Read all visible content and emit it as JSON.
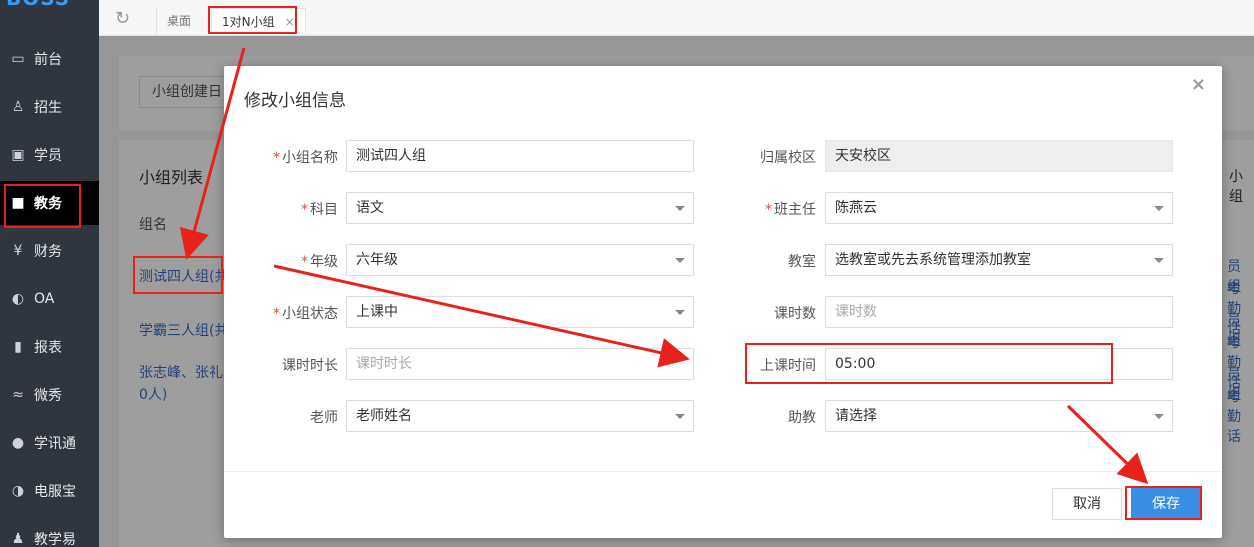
{
  "app": {
    "logo": "BOSS"
  },
  "sidebar": {
    "items": [
      {
        "label": "前台",
        "icon": "calendar-icon"
      },
      {
        "label": "招生",
        "icon": "user-add-icon"
      },
      {
        "label": "学员",
        "icon": "id-card-icon"
      },
      {
        "label": "教务",
        "icon": "book-icon",
        "active": true
      },
      {
        "label": "财务",
        "icon": "yen-icon"
      },
      {
        "label": "OA",
        "icon": "oa-icon"
      },
      {
        "label": "报表",
        "icon": "bar-chart-icon"
      },
      {
        "label": "微秀",
        "icon": "wei-icon"
      },
      {
        "label": "学讯通",
        "icon": "location-icon"
      },
      {
        "label": "电服宝",
        "icon": "phone-icon"
      },
      {
        "label": "教学易",
        "icon": "teach-icon"
      }
    ]
  },
  "tabs": {
    "desk": "桌面",
    "current": "1对N小组",
    "close": "×"
  },
  "background": {
    "filter_label": "小组创建日",
    "list_title": "小组列表",
    "col_name": "组名",
    "rows": [
      "测试四人组(共",
      "学霸三人组(共",
      "张志峰、张礼",
      "0人)"
    ],
    "right_header": "小组",
    "right_rows": [
      "员 组",
      "考勤 话",
      "员 组",
      "考勤 话",
      "员 组",
      "考勤 话"
    ]
  },
  "modal": {
    "title": "修改小组信息",
    "close": "×",
    "fields": {
      "group_name": {
        "label": "小组名称",
        "value": "测试四人组"
      },
      "campus": {
        "label": "归属校区",
        "value": "天安校区"
      },
      "subject": {
        "label": "科目",
        "value": "语文"
      },
      "head_teacher": {
        "label": "班主任",
        "value": "陈燕云"
      },
      "grade": {
        "label": "年级",
        "value": "六年级"
      },
      "classroom": {
        "label": "教室",
        "value": "选教室或先去系统管理添加教室"
      },
      "status": {
        "label": "小组状态",
        "value": "上课中"
      },
      "lesson_count": {
        "label": "课时数",
        "placeholder": "课时数"
      },
      "lesson_duration": {
        "label": "课时时长",
        "placeholder": "课时时长"
      },
      "class_time": {
        "label": "上课时间",
        "value": "05:00"
      },
      "teacher": {
        "label": "老师",
        "value": "老师姓名"
      },
      "assistant": {
        "label": "助教",
        "value": "请选择"
      }
    },
    "cancel": "取消",
    "save": "保存"
  },
  "colors": {
    "annotation": "#e8221b",
    "primary": "#3a8ee6",
    "sidebar": "#2f3640"
  }
}
